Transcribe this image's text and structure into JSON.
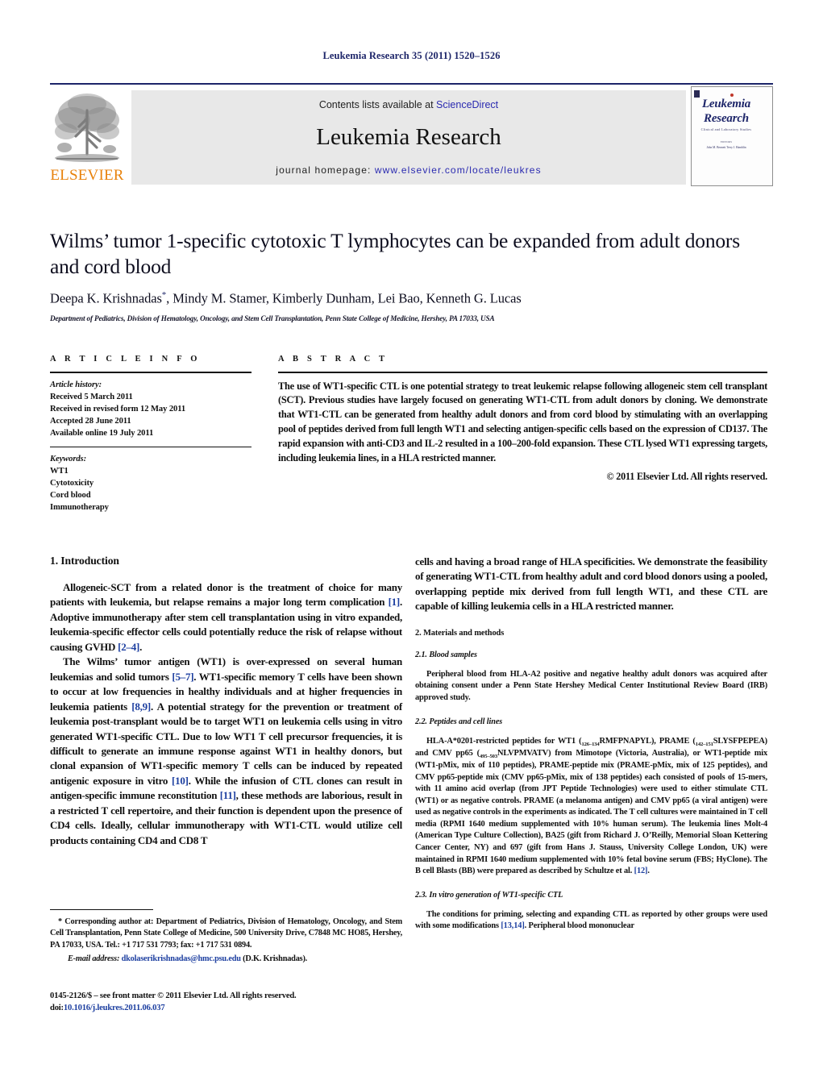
{
  "running_head": "Leukemia Research 35 (2011) 1520–1526",
  "masthead": {
    "publisher_name": "ELSEVIER",
    "contents_prefix": "Contents lists available at ",
    "contents_link": "ScienceDirect",
    "journal_name": "Leukemia Research",
    "homepage_prefix": "journal homepage: ",
    "homepage_link": "www.elsevier.com/locate/leukres",
    "cover": {
      "line1": "Leukemia",
      "line2": "Research",
      "subtitle": "Clinical and Laboratory Studies",
      "editors_label": "EDITORS",
      "editors": "John M. Bennett      Terry J. Hamblin"
    }
  },
  "article": {
    "title": "Wilms’ tumor 1-specific cytotoxic T lymphocytes can be expanded from adult donors and cord blood",
    "authors": "Deepa K. Krishnadas, Mindy M. Stamer, Kimberly Dunham, Lei Bao, Kenneth G. Lucas",
    "corresponding_marker": "*",
    "affiliation": "Department of Pediatrics, Division of Hematology, Oncology, and Stem Cell Transplantation, Penn State College of Medicine, Hershey, PA 17033, USA"
  },
  "article_info": {
    "heading": "A R T I C L E    I N F O",
    "history_label": "Article history:",
    "history": [
      "Received 5 March 2011",
      "Received in revised form 12 May 2011",
      "Accepted 28 June 2011",
      "Available online 19 July 2011"
    ],
    "keywords_label": "Keywords:",
    "keywords": [
      "WT1",
      "Cytotoxicity",
      "Cord blood",
      "Immunotherapy"
    ]
  },
  "abstract": {
    "heading": "A B S T R A C T",
    "text": "The use of WT1-specific CTL is one potential strategy to treat leukemic relapse following allogeneic stem cell transplant (SCT). Previous studies have largely focused on generating WT1-CTL from adult donors by cloning. We demonstrate that WT1-CTL can be generated from healthy adult donors and from cord blood by stimulating with an overlapping pool of peptides derived from full length WT1 and selecting antigen-specific cells based on the expression of CD137. The rapid expansion with anti-CD3 and IL-2 resulted in a 100–200-fold expansion. These CTL lysed WT1 expressing targets, including leukemia lines, in a HLA restricted manner.",
    "copyright": "© 2011 Elsevier Ltd. All rights reserved."
  },
  "sections": {
    "intro_heading": "1.  Introduction",
    "intro_p1_a": "Allogeneic-SCT from a related donor is the treatment of choice for many patients with leukemia, but relapse remains a major long term complication ",
    "intro_p1_ref1": "[1]",
    "intro_p1_b": ". Adoptive immunotherapy after stem cell transplantation using in vitro expanded, leukemia-specific effector cells could potentially reduce the risk of relapse without causing GVHD ",
    "intro_p1_ref2": "[2–4]",
    "intro_p1_c": ".",
    "intro_p2_a": "The Wilms’ tumor antigen (WT1) is over-expressed on several human leukemias and solid tumors ",
    "intro_p2_ref1": "[5–7]",
    "intro_p2_b": ". WT1-specific memory T cells have been shown to occur at low frequencies in healthy individuals and at higher frequencies in leukemia patients ",
    "intro_p2_ref2": "[8,9]",
    "intro_p2_c": ". A potential strategy for the prevention or treatment of leukemia post-transplant would be to target WT1 on leukemia cells using in vitro generated WT1-specific CTL. Due to low WT1 T cell precursor frequencies, it is difficult to generate an immune response against WT1 in healthy donors, but clonal expansion of WT1-specific memory T cells can be induced by repeated antigenic exposure in vitro ",
    "intro_p2_ref3": "[10]",
    "intro_p2_d": ". While the infusion of CTL clones can result in antigen-specific immune reconstitution ",
    "intro_p2_ref4": "[11]",
    "intro_p2_e": ", these methods are laborious, result in a restricted T cell repertoire, and their function is dependent upon the presence of CD4 cells. Ideally, cellular immunotherapy with WT1-CTL would utilize cell products containing CD4 and CD8 T",
    "intro_p2_cont": "cells and having a broad range of HLA specificities. We demonstrate the feasibility of generating WT1-CTL from healthy adult and cord blood donors using a pooled, overlapping peptide mix derived from full length WT1, and these CTL are capable of killing leukemia cells in a HLA restricted manner.",
    "methods_heading": "2.  Materials and methods",
    "blood_heading": "2.1.  Blood samples",
    "blood_text": "Peripheral blood from HLA-A2 positive and negative healthy adult donors was acquired after obtaining consent under a Penn State Hershey Medical Center Institutional Review Board (IRB) approved study.",
    "peptides_heading": "2.2.  Peptides and cell lines",
    "peptides_a": "HLA-A*0201-restricted peptides for WT1 (",
    "peptides_sub1": "126–134",
    "peptides_b": "RMFPNAPYL), PRAME (",
    "peptides_sub2": "142–151",
    "peptides_c": "SLYSFPEPEA) and CMV pp65 (",
    "peptides_sub3": "495–503",
    "peptides_d": "NLVPMVATV) from Mimotope (Victoria, Australia), or WT1-peptide mix (WT1-pMix, mix of 110 peptides), PRAME-peptide mix (PRAME-pMix, mix of 125 peptides), and CMV pp65-peptide mix (CMV pp65-pMix, mix of 138 peptides) each consisted of pools of 15-mers, with 11 amino acid overlap (from JPT Peptide Technologies) were used to either stimulate CTL (WT1) or as negative controls. PRAME (a melanoma antigen) and CMV pp65 (a viral antigen) were used as negative controls in the experiments as indicated. The T cell cultures were maintained in T cell media (RPMI 1640 medium supplemented with 10% human serum). The leukemia lines Molt-4 (American Type Culture Collection), BA25 (gift from Richard J. O’Reilly, Memorial Sloan Kettering Cancer Center, NY) and 697 (gift from Hans J. Stauss, University College London, UK) were maintained in RPMI 1640 medium supplemented with 10% fetal bovine serum (FBS; HyClone). The B cell Blasts (BB) were prepared as described by Schultze et al. ",
    "peptides_ref": "[12]",
    "peptides_e": ".",
    "invitro_heading": "2.3.  In vitro generation of WT1-specific CTL",
    "invitro_a": "The conditions for priming, selecting and expanding CTL as reported by other groups were used with some modifications ",
    "invitro_ref": "[13,14]",
    "invitro_b": ". Peripheral blood mononuclear"
  },
  "footnote": {
    "corresponding": "* Corresponding author at: Department of Pediatrics, Division of Hematology, Oncology, and Stem Cell Transplantation, Penn State College of Medicine, 500 University Drive, C7848 MC HO85, Hershey, PA 17033, USA. Tel.: +1 717 531 7793; fax: +1 717 531 0894.",
    "email_label": "E-mail address:",
    "email_address": "dkolaserikrishnadas@hmc.psu.edu",
    "email_owner": "(D.K. Krishnadas).",
    "issn_line": "0145-2126/$ – see front matter © 2011 Elsevier Ltd. All rights reserved.",
    "doi_label": "doi:",
    "doi_value": "10.1016/j.leukres.2011.06.037"
  },
  "colors": {
    "link": "#2a2ab0",
    "ref": "#1d3fa0",
    "runhead": "#1d2569",
    "elsevier_orange": "#e8820c",
    "band_bg": "#e8e8e8"
  }
}
